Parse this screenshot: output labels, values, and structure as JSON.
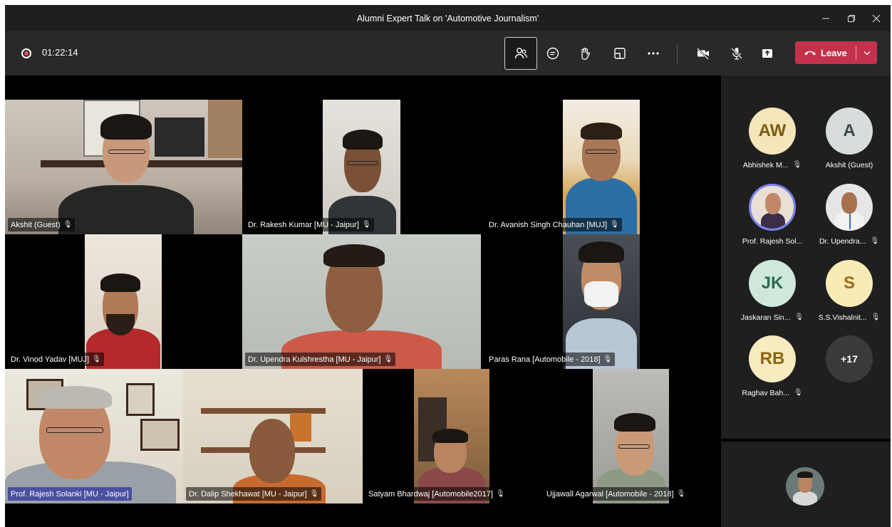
{
  "window": {
    "title": "Alumni Expert Talk on 'Automotive Journalism'",
    "controls": [
      "minimize-icon",
      "maximize-icon",
      "close-icon"
    ]
  },
  "toolbar": {
    "recording_time": "01:22:14",
    "buttons": [
      "people-icon",
      "chat-icon",
      "raise-hand-icon",
      "rooms-icon",
      "more-icon",
      "camera-off-icon",
      "mic-off-icon",
      "share-icon"
    ],
    "leave_label": "Leave"
  },
  "participants": [
    {
      "name": "Akshit (Guest)",
      "mic": "muted"
    },
    {
      "name": "Dr. Rakesh Kumar [MU - Jaipur]",
      "mic": "muted"
    },
    {
      "name": "Dr. Avanish Singh Chauhan [MUJ]",
      "mic": "muted"
    },
    {
      "name": "Dr. Vinod Yadav [MUJ]",
      "mic": "muted"
    },
    {
      "name": "Dr. Upendra Kulshrestha [MU - Jaipur]",
      "mic": "muted"
    },
    {
      "name": "Paras Rana [Automobile - 2018]",
      "mic": "muted"
    },
    {
      "name": "Prof. Rajesh Solanki [MU - Jaipur]",
      "mic": "speaking"
    },
    {
      "name": "Dr. Dalip Shekhawat [MU - Jaipur]",
      "mic": "muted"
    },
    {
      "name": "Satyam Bhardwaj [Automobile2017]",
      "mic": "muted"
    },
    {
      "name": "Ujjawall Agarwal [Automobile - 2018]",
      "mic": "muted"
    }
  ],
  "roster": [
    {
      "initials": "AW",
      "name": "Abhishek M...",
      "bg": "#f4e6b8",
      "fg": "#7a5a10"
    },
    {
      "initials": "A",
      "name": "Akshit (Guest)",
      "bg": "#d8dcdc",
      "fg": "#3a4a4a"
    },
    {
      "initials": "",
      "name": "Prof. Rajesh Sol...",
      "bg": "#5a4a3a",
      "fg": "#fff"
    },
    {
      "initials": "",
      "name": "Dr. Upendra...",
      "bg": "#e6e6e6",
      "fg": "#333"
    },
    {
      "initials": "JK",
      "name": "Jaskaran Sin...",
      "bg": "#cfe8dc",
      "fg": "#2e6b50"
    },
    {
      "initials": "S",
      "name": "S.S.Vishalnit...",
      "bg": "#f9ebb5",
      "fg": "#9a6a12"
    },
    {
      "initials": "RB",
      "name": "Raghav Bah...",
      "bg": "#f8ebc0",
      "fg": "#8a6410"
    },
    {
      "initials": "+17",
      "name": "",
      "bg": "#3a3a3a",
      "fg": "#fff"
    }
  ],
  "colors": {
    "titlebar": "#1f1f1f",
    "toolbar": "#292929",
    "leave": "#c4314b",
    "speaking_nameplate": "#4a4fa0",
    "roster_bg": "#1f1f1f"
  }
}
